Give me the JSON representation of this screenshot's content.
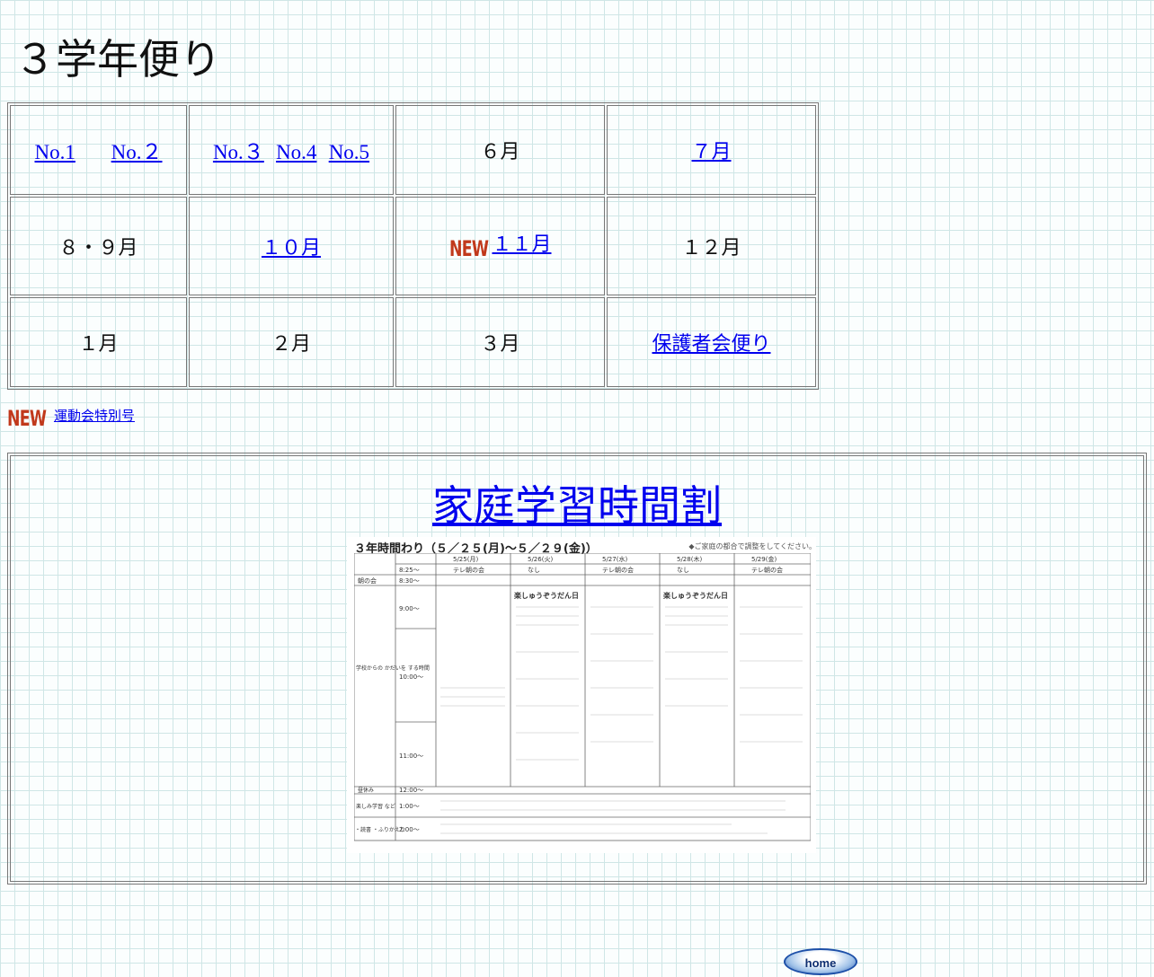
{
  "page": {
    "title": "３学年便り"
  },
  "months_table": {
    "row1": {
      "c1": {
        "link1": "No.1",
        "link2": "No.２"
      },
      "c2": {
        "link1": "No.３",
        "link2": "No.4",
        "link3": "No.5"
      },
      "c3": {
        "text": "６月"
      },
      "c4": {
        "link": "７月"
      }
    },
    "row2": {
      "c1": {
        "text": "８・９月"
      },
      "c2": {
        "link": "１０月"
      },
      "c3": {
        "badge": "NEW",
        "link": "１１月"
      },
      "c4": {
        "text": "１２月"
      }
    },
    "row3": {
      "c1": {
        "text": "１月"
      },
      "c2": {
        "text": "２月"
      },
      "c3": {
        "text": "３月"
      },
      "c4": {
        "link": "保護者会便り"
      }
    }
  },
  "special": {
    "badge": "NEW",
    "link": "運動会特別号"
  },
  "study": {
    "title": "家庭学習時間割",
    "timetable": {
      "title": "３年時間わり（５／２５(月)～５／２９(金)）",
      "note": "◆ご家庭の都合で調整をしてください。",
      "days": [
        "5/25(月)",
        "5/26(火)",
        "5/27(水)",
        "5/28(木)",
        "5/29(金)"
      ],
      "times": [
        "8:25～",
        "8:30～",
        "9:00～",
        "10:00～",
        "11:00～",
        "12:00～",
        "1:00～",
        "2:00～"
      ],
      "row_labels": [
        "朝の会",
        "学校からの かだいを する時間",
        "昼休み",
        "楽しみ学習 など",
        "・読書 ・ふりかえり"
      ],
      "sub": [
        "テレ朝の会",
        "なし",
        "テレ朝の会",
        "なし",
        "テレ朝の会"
      ],
      "highlight": "楽しゅうぞうだん日"
    }
  },
  "footer": {
    "home": "home"
  }
}
